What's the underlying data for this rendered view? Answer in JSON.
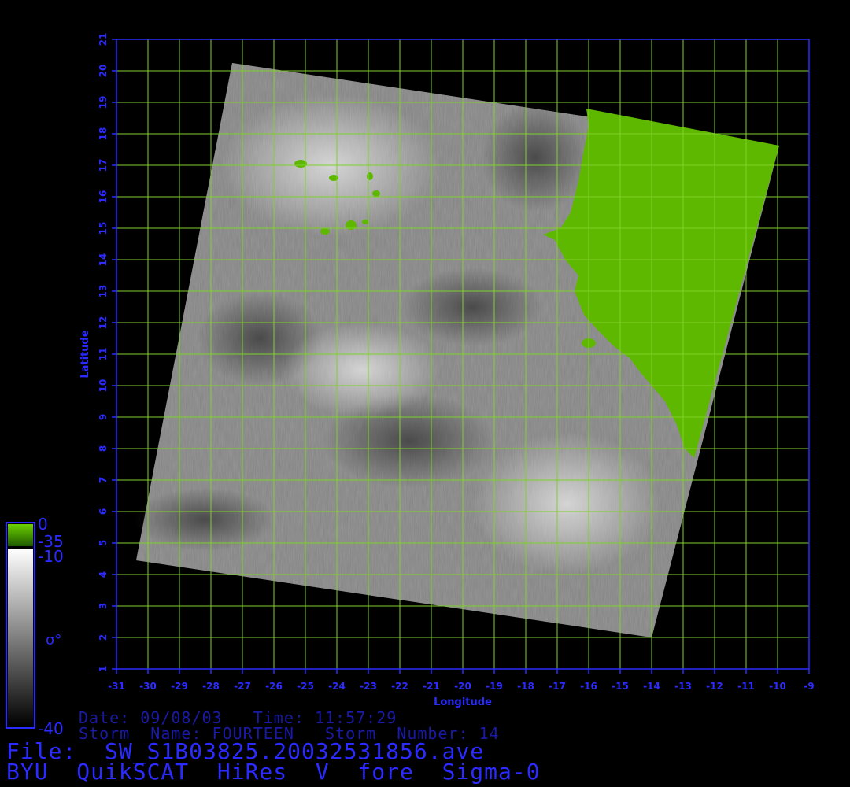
{
  "colors": {
    "background": "#000000",
    "grid": "#7fd12a",
    "axis": "#2b2bff",
    "land": "#5fb800",
    "text_dark_blue": "#1a1aa6"
  },
  "info": {
    "date_line": "Date: 09/08/03   Time: 11:57:29",
    "storm_line": "Storm  Name: FOURTEEN   Storm  Number: 14",
    "file_line": "File:  SW_S1B03825.20032531856.ave",
    "title_line": "BYU  QuikSCAT  HiRes  V  fore  Sigma-0"
  },
  "colorbar": {
    "labels": {
      "top": "0",
      "land_threshold": "-35",
      "upper": "-10",
      "symbol": "σ°",
      "bottom": "-40"
    }
  },
  "chart_data": {
    "type": "heatmap",
    "xlabel": "Longitude",
    "ylabel": "Latitude",
    "xlim": [
      -31,
      -9
    ],
    "ylim": [
      1,
      21
    ],
    "x_ticks": [
      "-31",
      "-30",
      "-29",
      "-28",
      "-27",
      "-26",
      "-25",
      "-24",
      "-23",
      "-22",
      "-21",
      "-20",
      "-19",
      "-18",
      "-17",
      "-16",
      "-15",
      "-14",
      "-13",
      "-12",
      "-11",
      "-10",
      "-9"
    ],
    "y_ticks": [
      "1",
      "2",
      "3",
      "4",
      "5",
      "6",
      "7",
      "8",
      "9",
      "10",
      "11",
      "12",
      "13",
      "14",
      "15",
      "16",
      "17",
      "18",
      "19",
      "20",
      "21"
    ],
    "grid": true,
    "swath_corners_lonlat": [
      [
        -27.1,
        20.3
      ],
      [
        -9.9,
        17.7
      ],
      [
        -13.9,
        2.1
      ],
      [
        -30.9,
        4.5
      ]
    ],
    "colorbar": {
      "min": -40,
      "max": 0,
      "ocean_range": [
        -40,
        -10
      ],
      "land_range": [
        -35,
        0
      ]
    }
  }
}
